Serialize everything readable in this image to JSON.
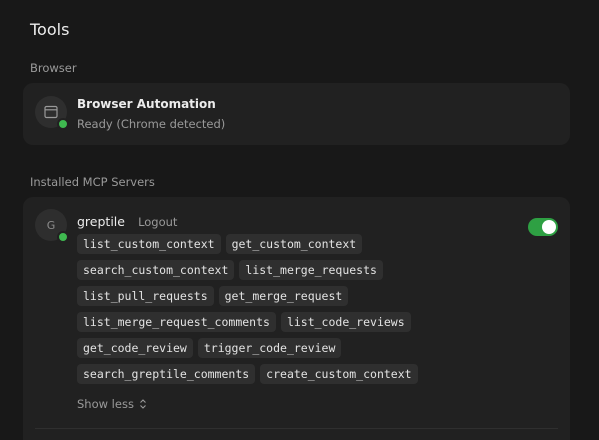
{
  "page": {
    "title": "Tools"
  },
  "browser_section": {
    "label": "Browser",
    "item": {
      "name": "Browser Automation",
      "status": "Ready (Chrome detected)",
      "icon": "browser-window-icon"
    }
  },
  "mcp_section": {
    "label": "Installed MCP Servers",
    "servers": [
      {
        "avatar_letter": "G",
        "name": "greptile",
        "logout_label": "Logout",
        "enabled": true,
        "tools": [
          "list_custom_context",
          "get_custom_context",
          "search_custom_context",
          "list_merge_requests",
          "list_pull_requests",
          "get_merge_request",
          "list_merge_request_comments",
          "list_code_reviews",
          "get_code_review",
          "trigger_code_review",
          "search_greptile_comments",
          "create_custom_context"
        ],
        "show_less_label": "Show less"
      }
    ]
  },
  "colors": {
    "accent_green": "#2ea043",
    "status_green": "#3fb950"
  }
}
